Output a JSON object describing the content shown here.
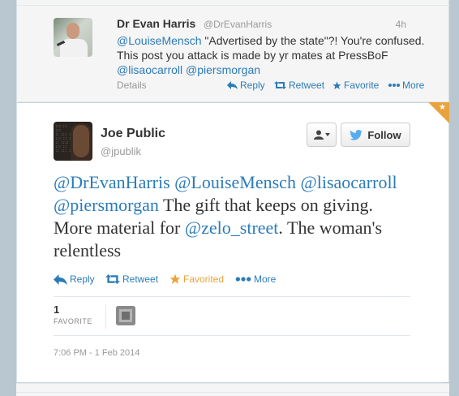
{
  "parent_tweet": {
    "name": "Dr Evan Harris",
    "handle": "@DrEvanHarris",
    "time": "4h",
    "text_mention1": "@LouiseMensch",
    "text_part1": " \"Advertised by the state\"?! You're confused. This post you attack is made by yr mates at PressBoF ",
    "text_mention2": "@lisaocarroll",
    "text_space": " ",
    "text_mention3": "@piersmorgan",
    "details_label": "Details",
    "reply_label": "Reply",
    "retweet_label": "Retweet",
    "favorite_label": "Favorite",
    "more_label": "More"
  },
  "main_tweet": {
    "name": "Joe Public",
    "handle": "@jpublik",
    "follow_label": "Follow",
    "text_mention1": "@DrEvanHarris",
    "text_mention2": "@LouiseMensch",
    "text_mention3": "@lisaocarroll",
    "text_mention4": "@piersmorgan",
    "text_part1": " The gift that keeps on giving. More material for ",
    "text_mention5": "@zelo_street",
    "text_part2": ". The woman's relentless",
    "reply_label": "Reply",
    "retweet_label": "Retweet",
    "favorited_label": "Favorited",
    "more_label": "More",
    "favorite_count": "1",
    "favorite_stat_label": "FAVORITE",
    "timestamp": "7:06 PM - 1 Feb 2014"
  },
  "colors": {
    "link": "#2b7bb9",
    "favorite_accent": "#e8a33c",
    "muted": "#999999"
  },
  "icons": [
    "reply-icon",
    "retweet-icon",
    "favorite-star-icon",
    "more-dots-icon",
    "user-menu-icon",
    "twitter-bird-icon"
  ]
}
